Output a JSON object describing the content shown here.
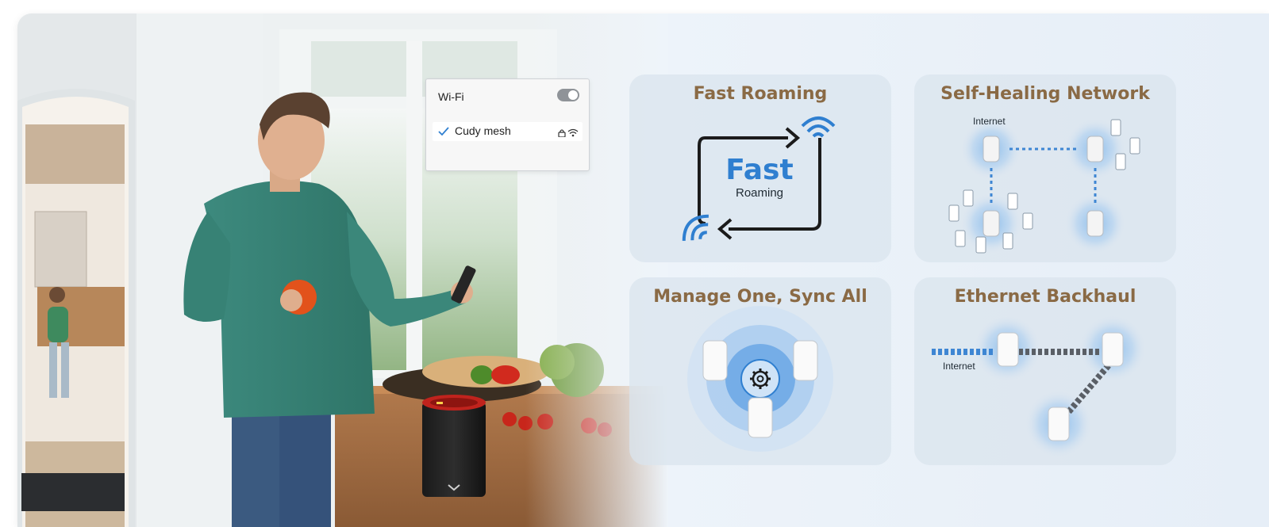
{
  "wifi_popup": {
    "wifi_label": "Wi-Fi",
    "network_name": "Cudy mesh"
  },
  "features": {
    "fast_roaming": {
      "title": "Fast Roaming",
      "center_big": "Fast",
      "center_small": "Roaming"
    },
    "self_healing": {
      "title": "Self-Healing Network",
      "internet_label": "Internet"
    },
    "manage_sync": {
      "title": "Manage One, Sync All"
    },
    "ethernet_backhaul": {
      "title": "Ethernet Backhaul",
      "internet_label": "Internet"
    }
  },
  "colors": {
    "accent_blue": "#2f7fd0",
    "title_brown": "#8a6a45",
    "tile_bg": "#dae4ee"
  },
  "icons": [
    "check-icon",
    "lock-icon",
    "wifi-icon",
    "gear-icon",
    "router-icon",
    "phone-icon"
  ]
}
